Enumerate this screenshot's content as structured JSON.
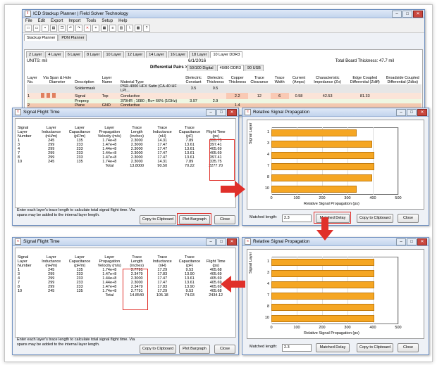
{
  "main": {
    "title": "ICD Stackup Planner | Field Solver Technology",
    "menu": [
      "File",
      "Edit",
      "Export",
      "Import",
      "Tools",
      "Setup",
      "Help"
    ],
    "top_tabs": [
      "Stackup Planner",
      "PDN Planner"
    ],
    "layer_tabs": [
      "2 Layer",
      "4 Layer",
      "6 Layer",
      "8 Layer",
      "10 Layer",
      "12 Layer",
      "14 Layer",
      "16 Layer",
      "18 Layer",
      "10 Layer DDR3"
    ],
    "units": "UNITS: mil",
    "date": "6/1/2016",
    "total_thickness": "Total Board Thickness: 47.7 mil",
    "diff_pairs_label": "Differential Pairs >",
    "diff_tabs": [
      "50/100 Digital",
      "40/80 DDR3",
      "90 USB"
    ],
    "headers": [
      "Layer No.",
      "Via Span & Hole Diameter",
      "Description",
      "Layer Name",
      "Material Type",
      "Dielectric Constant",
      "Dielectric Thickness",
      "Copper Thickness",
      "Trace Clearance",
      "Trace Width",
      "Current (Amps)",
      "Characteristic Impedance (Zo)",
      "Edge Coupled Differential (Zdiff)",
      "Broadside Coupled Differential (Zdbs)"
    ],
    "rows": [
      {
        "no": "",
        "desc": "Soldermask",
        "name": "",
        "mat": "PSR-4000 HFX Satin (CA-40 HF LPI...",
        "dk": "3.5",
        "dt": "0.5",
        "cu": "",
        "cl": "",
        "tw": "",
        "amp": "",
        "zo": "",
        "zd": "",
        "zb": ""
      },
      {
        "no": "1",
        "desc": "Signal",
        "name": "Top",
        "mat": "Conductive",
        "dk": "",
        "dt": "",
        "cu": "2.2",
        "cl": "12",
        "tw": "6",
        "amp": "0.58",
        "zo": "42.53",
        "zd": "81.33",
        "zb": ""
      },
      {
        "no": "",
        "desc": "Prepreg",
        "name": "",
        "mat": "370HR ; 1080 ; Rc= 66% (1GHz)",
        "dk": "3.97",
        "dt": "2.9",
        "cu": "",
        "cl": "",
        "tw": "",
        "amp": "",
        "zo": "",
        "zd": "",
        "zb": ""
      },
      {
        "no": "2",
        "desc": "Plane",
        "name": "GND",
        "mat": "Conductive",
        "dk": "",
        "dt": "",
        "cu": "1.4",
        "cl": "",
        "tw": "",
        "amp": "",
        "zo": "",
        "zd": "",
        "zb": ""
      }
    ]
  },
  "sft_title": "Signal Flight Time",
  "rsp_title": "Relative Signal Propagation",
  "sft_headers": [
    "Signal Layer Number",
    "Layer Inductance (nH/m)",
    "Layer Capacitance (pF/m)",
    "Layer Propagation Velocity (m/s)",
    "Trace Length (inches)",
    "Trace Inductance (nH)",
    "Trace Capacitance (pF)",
    "Flight Time (ps)"
  ],
  "sft_top": {
    "rows": [
      [
        "1",
        "245",
        "135",
        "1.74e+8",
        "2.3000",
        "14.31",
        "7.89",
        "335.75"
      ],
      [
        "3",
        "299",
        "233",
        "1.47e+8",
        "2.3000",
        "17.47",
        "13.61",
        "397.41"
      ],
      [
        "4",
        "299",
        "233",
        "1.44e+8",
        "2.3000",
        "17.47",
        "13.61",
        "405.69"
      ],
      [
        "7",
        "299",
        "233",
        "1.44e+8",
        "2.3000",
        "17.47",
        "13.61",
        "405.69"
      ],
      [
        "8",
        "299",
        "233",
        "1.47e+8",
        "2.3000",
        "17.47",
        "13.61",
        "397.41"
      ],
      [
        "10",
        "245",
        "135",
        "1.74e+8",
        "2.3000",
        "14.31",
        "7.89",
        "335.75"
      ]
    ],
    "total": [
      "Total",
      "13.8000",
      "90.50",
      "70.22",
      "2277.70"
    ],
    "note": "Enter each layer's trace length to calculate total signal flight time. Via spans may be added to the internal layer length.",
    "btn_copy": "Copy to Clipboard",
    "btn_plot": "Plot Bargraph",
    "btn_close": "Close"
  },
  "sft_bottom": {
    "rows": [
      [
        "1",
        "245",
        "135",
        "1.74e+8",
        "2.7791",
        "17.29",
        "9.53",
        "405.68"
      ],
      [
        "3",
        "299",
        "233",
        "1.47e+8",
        "2.3479",
        "17.83",
        "13.90",
        "405.69"
      ],
      [
        "4",
        "299",
        "233",
        "1.44e+8",
        "2.3000",
        "17.47",
        "13.61",
        "405.69"
      ],
      [
        "7",
        "299",
        "233",
        "1.44e+8",
        "2.3000",
        "17.47",
        "13.61",
        "405.69"
      ],
      [
        "8",
        "299",
        "233",
        "1.47e+8",
        "2.3479",
        "17.83",
        "13.90",
        "405.69"
      ],
      [
        "10",
        "245",
        "135",
        "1.74e+8",
        "2.7791",
        "17.29",
        "9.53",
        "405.68"
      ]
    ],
    "total": [
      "Total",
      "14.8540",
      "105.18",
      "74.03",
      "2434.12"
    ],
    "note": "Enter each layer's trace length to calculate total signal flight time. Via spans may be added to the internal layer length.",
    "btn_copy": "Copy to Clipboard",
    "btn_plot": "Plot Bargraph",
    "btn_close": "Close"
  },
  "rsp_common": {
    "ylabel": "Signal Layer",
    "xlabel": "Relative Signal Propagation (ps)",
    "matched_label": "Matched length:",
    "btn_matched": "Matched Delay",
    "btn_copy": "Copy to Clipboard",
    "btn_close": "Close"
  },
  "rsp_top_matched": "2.3",
  "rsp_bottom_matched": "2.3",
  "chart_data": [
    {
      "type": "bar",
      "orientation": "horizontal",
      "categories": [
        "1",
        "3",
        "4",
        "7",
        "8",
        "10"
      ],
      "values": [
        335.75,
        397.41,
        405.69,
        405.69,
        397.41,
        335.75
      ],
      "xlim": [
        0,
        500
      ],
      "xticks": [
        "0",
        "100",
        "200",
        "300",
        "400",
        "500"
      ],
      "xlabel": "Relative Signal Propagation (ps)",
      "ylabel": "Signal Layer",
      "grid": true
    },
    {
      "type": "bar",
      "orientation": "horizontal",
      "categories": [
        "1",
        "3",
        "4",
        "7",
        "8",
        "10"
      ],
      "values": [
        405.68,
        405.69,
        405.69,
        405.69,
        405.69,
        405.68
      ],
      "xlim": [
        0,
        500
      ],
      "xticks": [
        "0",
        "100",
        "200",
        "300",
        "400",
        "500"
      ],
      "xlabel": "Relative Signal Propagation (ps)",
      "ylabel": "Signal Layer",
      "grid": true
    }
  ],
  "colors": {
    "bar": "#f5a623",
    "highlight": "#e0302a",
    "accent_row": "#f9c9b4"
  }
}
